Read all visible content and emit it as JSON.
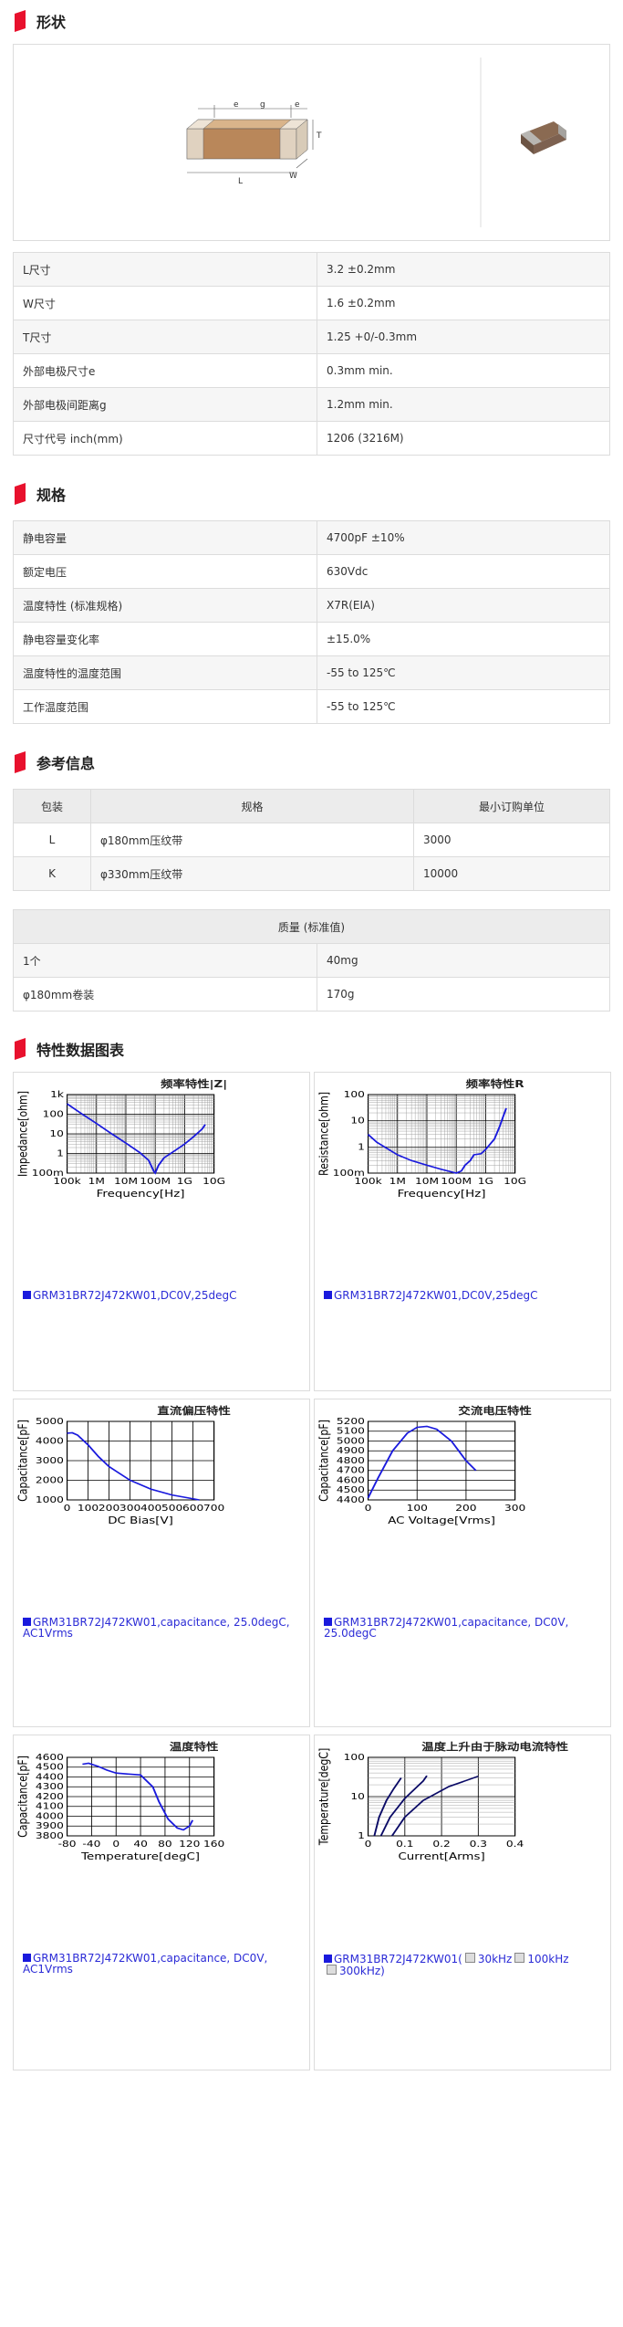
{
  "sections": {
    "shape": "形状",
    "spec": "规格",
    "ref": "参考信息",
    "charts": "特性数据图表"
  },
  "shape_labels": {
    "e1": "e",
    "g": "g",
    "e2": "e",
    "t": "T",
    "l": "L",
    "w": "W"
  },
  "shape_rows": [
    {
      "label": "L尺寸",
      "value": "3.2 ±0.2mm"
    },
    {
      "label": "W尺寸",
      "value": "1.6 ±0.2mm"
    },
    {
      "label": "T尺寸",
      "value": "1.25 +0/-0.3mm"
    },
    {
      "label": "外部电极尺寸e",
      "value": "0.3mm min."
    },
    {
      "label": "外部电极间距离g",
      "value": "1.2mm min."
    },
    {
      "label": "尺寸代号 inch(mm)",
      "value": "1206 (3216M)"
    }
  ],
  "spec_rows": [
    {
      "label": "静电容量",
      "value": "4700pF ±10%"
    },
    {
      "label": "额定电压",
      "value": "630Vdc"
    },
    {
      "label": "温度特性 (标准规格)",
      "value": "X7R(EIA)"
    },
    {
      "label": "静电容量变化率",
      "value": "±15.0%"
    },
    {
      "label": "温度特性的温度范围",
      "value": "-55 to 125℃"
    },
    {
      "label": "工作温度范围",
      "value": "-55 to 125℃"
    }
  ],
  "packaging": {
    "headers": [
      "包装",
      "规格",
      "最小订购单位"
    ],
    "rows": [
      [
        "L",
        "φ180mm压纹带",
        "3000"
      ],
      [
        "K",
        "φ330mm压纹带",
        "10000"
      ]
    ]
  },
  "mass": {
    "header": "质量 (标准值)",
    "rows": [
      [
        "1个",
        "40mg"
      ],
      [
        "φ180mm卷装",
        "170g"
      ]
    ]
  },
  "colors": {
    "accent": "#e8112d",
    "curve": "#1a1add",
    "legend": "#2b2bd6"
  },
  "chart_data": [
    {
      "type": "line",
      "title": "频率特性|Z|",
      "xlabel": "Frequency[Hz]",
      "ylabel": "Impedance[ohm]",
      "xticks": [
        "100k",
        "1M",
        "10M",
        "100M",
        "1G",
        "10G"
      ],
      "yticks": [
        "1k",
        "100",
        "10",
        "1",
        "100m"
      ],
      "log_x": true,
      "log_y": true,
      "xlim": [
        100000,
        10000000000
      ],
      "ylim": [
        0.1,
        1000
      ],
      "series": [
        {
          "name": "GRM31BR72J472KW01,DC0V,25degC",
          "x": [
            100000,
            300000,
            1000000,
            3000000,
            10000000,
            30000000,
            60000000,
            90000000,
            100000000,
            130000000,
            200000000,
            500000000,
            1000000000,
            2000000000,
            4000000000,
            5000000000
          ],
          "y": [
            340,
            110,
            34,
            11,
            3.4,
            1.1,
            0.45,
            0.12,
            0.1,
            0.25,
            0.6,
            1.5,
            3,
            7,
            18,
            30
          ]
        }
      ]
    },
    {
      "type": "line",
      "title": "频率特性R",
      "xlabel": "Frequency[Hz]",
      "ylabel": "Resistance[ohm]",
      "xticks": [
        "100k",
        "1M",
        "10M",
        "100M",
        "1G",
        "10G"
      ],
      "yticks": [
        "100",
        "10",
        "1",
        "100m"
      ],
      "log_x": true,
      "log_y": true,
      "xlim": [
        100000,
        10000000000
      ],
      "ylim": [
        0.1,
        100
      ],
      "series": [
        {
          "name": "GRM31BR72J472KW01,DC0V,25degC",
          "x": [
            100000,
            200000,
            500000,
            1000000,
            3000000,
            10000000,
            30000000,
            100000000,
            150000000,
            200000000,
            300000000,
            400000000,
            700000000,
            1000000000,
            2000000000,
            3000000000,
            4000000000,
            5000000000
          ],
          "y": [
            3,
            1.5,
            0.8,
            0.5,
            0.3,
            0.2,
            0.14,
            0.1,
            0.12,
            0.2,
            0.3,
            0.5,
            0.55,
            0.8,
            2,
            6,
            15,
            30
          ]
        }
      ]
    },
    {
      "type": "line",
      "title": "直流偏压特性",
      "xlabel": "DC Bias[V]",
      "ylabel": "Capacitance[pF]",
      "xticks": [
        "0",
        "100",
        "200",
        "300",
        "400",
        "500",
        "600",
        "700"
      ],
      "yticks": [
        "5000",
        "4000",
        "3000",
        "2000",
        "1000"
      ],
      "xlim": [
        0,
        700
      ],
      "ylim": [
        1000,
        5000
      ],
      "series": [
        {
          "name": "GRM31BR72J472KW01,capacitance, 25.0degC, AC1Vrms",
          "x": [
            0,
            25,
            50,
            100,
            150,
            200,
            300,
            400,
            500,
            630
          ],
          "y": [
            4400,
            4420,
            4300,
            3800,
            3200,
            2700,
            2000,
            1550,
            1250,
            1000
          ]
        }
      ]
    },
    {
      "type": "line",
      "title": "交流电压特性",
      "xlabel": "AC Voltage[Vrms]",
      "ylabel": "Capacitance[pF]",
      "xticks": [
        "0",
        "100",
        "200",
        "300"
      ],
      "yticks": [
        "5200",
        "5100",
        "5000",
        "4900",
        "4800",
        "4700",
        "4600",
        "4500",
        "4400"
      ],
      "xlim": [
        0,
        300
      ],
      "ylim": [
        4400,
        5200
      ],
      "series": [
        {
          "name": "GRM31BR72J472KW01,capacitance, DC0V, 25.0degC",
          "x": [
            0,
            20,
            50,
            80,
            100,
            120,
            140,
            170,
            200,
            220
          ],
          "y": [
            4420,
            4620,
            4900,
            5080,
            5140,
            5150,
            5120,
            5000,
            4800,
            4700
          ]
        }
      ]
    },
    {
      "type": "line",
      "title": "温度特性",
      "xlabel": "Temperature[degC]",
      "ylabel": "Capacitance[pF]",
      "xticks": [
        "-80",
        "-40",
        "0",
        "40",
        "80",
        "120",
        "160"
      ],
      "yticks": [
        "4600",
        "4500",
        "4400",
        "4300",
        "4200",
        "4100",
        "4000",
        "3900",
        "3800"
      ],
      "xlim": [
        -80,
        160
      ],
      "ylim": [
        3800,
        4600
      ],
      "series": [
        {
          "name": "GRM31BR72J472KW01,capacitance, DC0V, AC1Vrms",
          "x": [
            -55,
            -45,
            -30,
            -15,
            0,
            20,
            40,
            60,
            70,
            85,
            100,
            110,
            120,
            125
          ],
          "y": [
            4530,
            4540,
            4510,
            4470,
            4440,
            4430,
            4420,
            4300,
            4150,
            3970,
            3880,
            3860,
            3900,
            3960
          ]
        }
      ]
    },
    {
      "type": "line",
      "title": "温度上升由于脉动电流特性",
      "xlabel": "Current[Arms]",
      "ylabel": "Temperature[degC]",
      "xticks": [
        "0",
        "0.1",
        "0.2",
        "0.3",
        "0.4"
      ],
      "yticks": [
        "100",
        "10",
        "1"
      ],
      "log_y": true,
      "xlim": [
        0,
        0.4
      ],
      "ylim": [
        1,
        100
      ],
      "legend_prefix": "GRM31BR72J472KW01(",
      "legend_items": [
        "30kHz",
        "100kHz",
        "300kHz)"
      ],
      "series": [
        {
          "name": "30kHz",
          "x": [
            0.017,
            0.03,
            0.05,
            0.07,
            0.09
          ],
          "y": [
            1,
            3,
            8,
            16,
            30
          ]
        },
        {
          "name": "100kHz",
          "x": [
            0.035,
            0.06,
            0.1,
            0.15,
            0.16
          ],
          "y": [
            1,
            3,
            9,
            25,
            34
          ]
        },
        {
          "name": "300kHz",
          "x": [
            0.065,
            0.1,
            0.15,
            0.22,
            0.3
          ],
          "y": [
            1,
            3,
            8,
            18,
            33
          ]
        }
      ]
    }
  ]
}
